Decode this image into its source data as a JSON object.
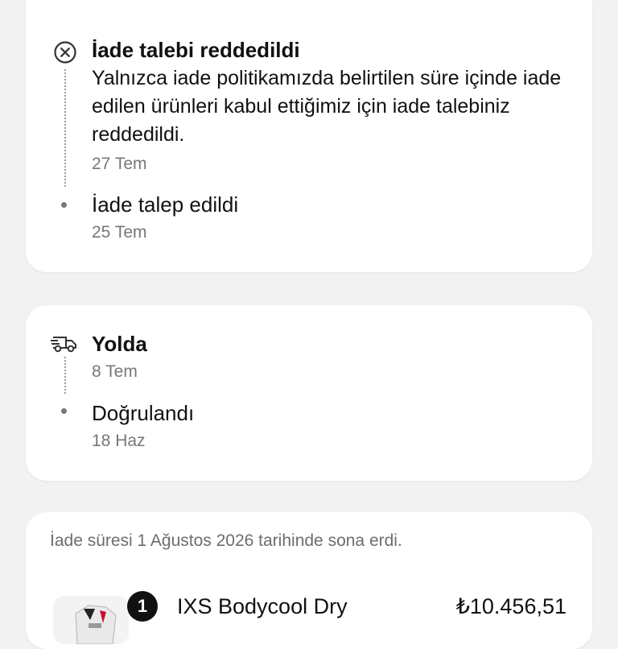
{
  "refund_card": {
    "events": [
      {
        "title": "İade talebi reddedildi",
        "desc": "Yalnızca iade politikamızda belirtilen süre içinde iade edilen ürünleri kabul ettiğimiz için iade talebiniz reddedildi.",
        "date": "27 Tem",
        "icon": "x-circle-icon"
      },
      {
        "title": "İade talep edildi",
        "date": "25 Tem",
        "icon": "dot"
      }
    ]
  },
  "shipping_card": {
    "events": [
      {
        "title": "Yolda",
        "date": "8 Tem",
        "icon": "delivery-truck-icon"
      },
      {
        "title": "Doğrulandı",
        "date": "18 Haz",
        "icon": "dot"
      }
    ]
  },
  "product_card": {
    "return_note": "İade süresi 1 Ağustos 2026 tarihinde sona erdi.",
    "item": {
      "quantity": "1",
      "name": "IXS Bodycool Dry",
      "price": "₺10.456,51"
    }
  }
}
